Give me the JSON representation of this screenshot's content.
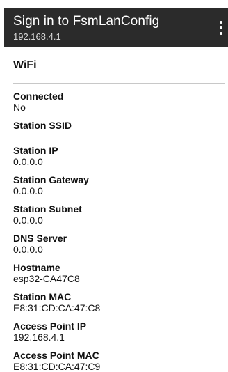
{
  "appbar": {
    "title": "Sign in to FsmLanConfig",
    "subtitle": "192.168.4.1",
    "menu_icon": "more-vert-icon"
  },
  "section": {
    "title": "WiFi"
  },
  "fields": [
    {
      "label": "Connected",
      "value": "No"
    },
    {
      "label": "Station SSID",
      "value": ""
    },
    {
      "label": "Station IP",
      "value": "0.0.0.0"
    },
    {
      "label": "Station Gateway",
      "value": "0.0.0.0"
    },
    {
      "label": "Station Subnet",
      "value": "0.0.0.0"
    },
    {
      "label": "DNS Server",
      "value": "0.0.0.0"
    },
    {
      "label": "Hostname",
      "value": "esp32-CA47C8"
    },
    {
      "label": "Station MAC",
      "value": "E8:31:CD:CA:47:C8"
    },
    {
      "label": "Access Point IP",
      "value": "192.168.4.1"
    },
    {
      "label": "Access Point MAC",
      "value": "E8:31:CD:CA:47:C9"
    }
  ],
  "colors": {
    "appbar_bg": "#2b2b2b",
    "text": "#111111",
    "divider": "#c8c8c8"
  }
}
